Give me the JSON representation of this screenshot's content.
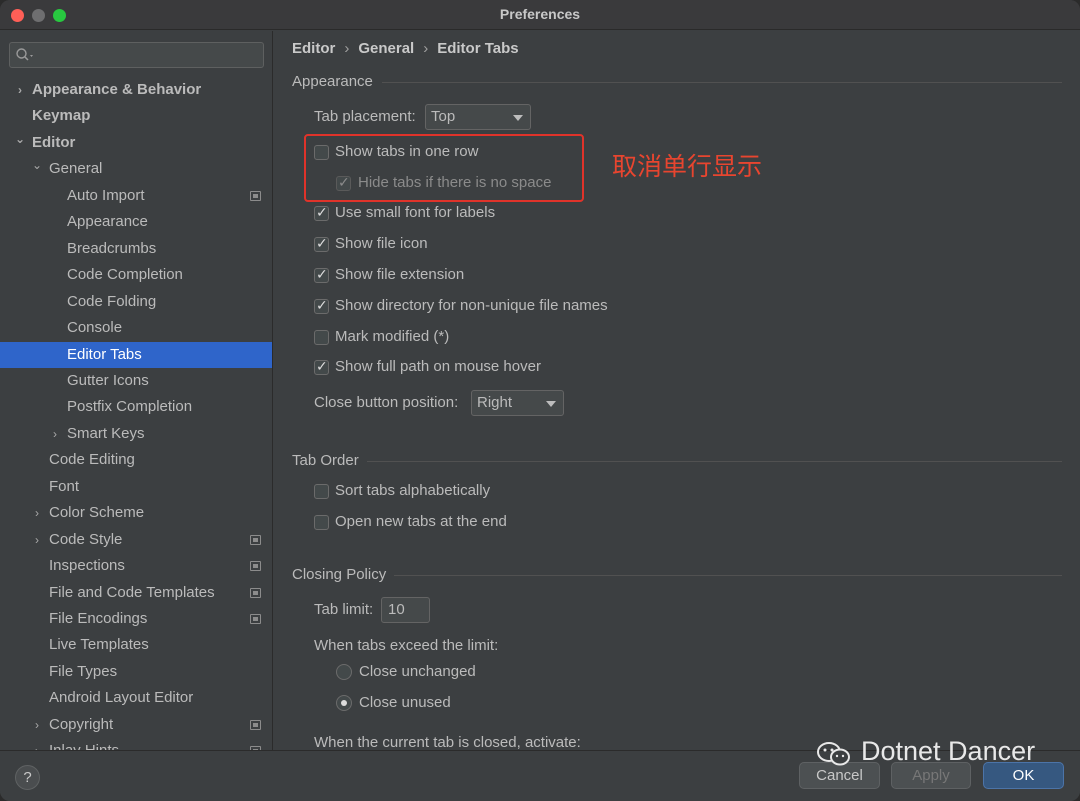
{
  "window": {
    "title": "Preferences"
  },
  "search": {
    "placeholder": ""
  },
  "sidebar": {
    "items": [
      {
        "label": "Appearance & Behavior",
        "arrow": "›",
        "bold": true
      },
      {
        "label": "Keymap",
        "bold": true
      },
      {
        "label": "Editor",
        "arrow": "⌄",
        "bold": true
      },
      {
        "label": "General",
        "arrow": "⌄"
      },
      {
        "label": "Auto Import",
        "copy": true
      },
      {
        "label": "Appearance"
      },
      {
        "label": "Breadcrumbs"
      },
      {
        "label": "Code Completion"
      },
      {
        "label": "Code Folding"
      },
      {
        "label": "Console"
      },
      {
        "label": "Editor Tabs",
        "selected": true
      },
      {
        "label": "Gutter Icons"
      },
      {
        "label": "Postfix Completion"
      },
      {
        "label": "Smart Keys",
        "arrow": "›"
      },
      {
        "label": "Code Editing"
      },
      {
        "label": "Font"
      },
      {
        "label": "Color Scheme",
        "arrow": "›"
      },
      {
        "label": "Code Style",
        "arrow": "›",
        "copy": true
      },
      {
        "label": "Inspections",
        "copy": true
      },
      {
        "label": "File and Code Templates",
        "copy": true
      },
      {
        "label": "File Encodings",
        "copy": true
      },
      {
        "label": "Live Templates"
      },
      {
        "label": "File Types"
      },
      {
        "label": "Android Layout Editor"
      },
      {
        "label": "Copyright",
        "arrow": "›",
        "copy": true
      },
      {
        "label": "Inlay Hints",
        "arrow": "›",
        "copy": true
      }
    ]
  },
  "breadcrumb": {
    "part1": "Editor",
    "part2": "General",
    "part3": "Editor Tabs",
    "sep": "›"
  },
  "appearance": {
    "heading": "Appearance",
    "tab_placement_label": "Tab placement:",
    "tab_placement_value": "Top",
    "show_tabs_one_row": "Show tabs in one row",
    "hide_tabs": "Hide tabs if there is no space",
    "small_font": "Use small font for labels",
    "file_icon": "Show file icon",
    "file_extension": "Show file extension",
    "directory": "Show directory for non-unique file names",
    "mark_modified": "Mark modified (*)",
    "full_path": "Show full path on mouse hover",
    "close_button_label": "Close button position:",
    "close_button_value": "Right"
  },
  "tab_order": {
    "heading": "Tab Order",
    "sort": "Sort tabs alphabetically",
    "open_new": "Open new tabs at the end"
  },
  "closing_policy": {
    "heading": "Closing Policy",
    "tab_limit_label": "Tab limit:",
    "tab_limit_value": "10",
    "exceed_label": "When tabs exceed the limit:",
    "close_unchanged": "Close unchanged",
    "close_unused": "Close unused",
    "current_closed_label": "When the current tab is closed, activate:"
  },
  "annotation": {
    "text": "取消单行显示"
  },
  "footer": {
    "help": "?",
    "cancel": "Cancel",
    "apply": "Apply",
    "ok": "OK"
  },
  "watermark": {
    "text": "Dotnet Dancer"
  }
}
